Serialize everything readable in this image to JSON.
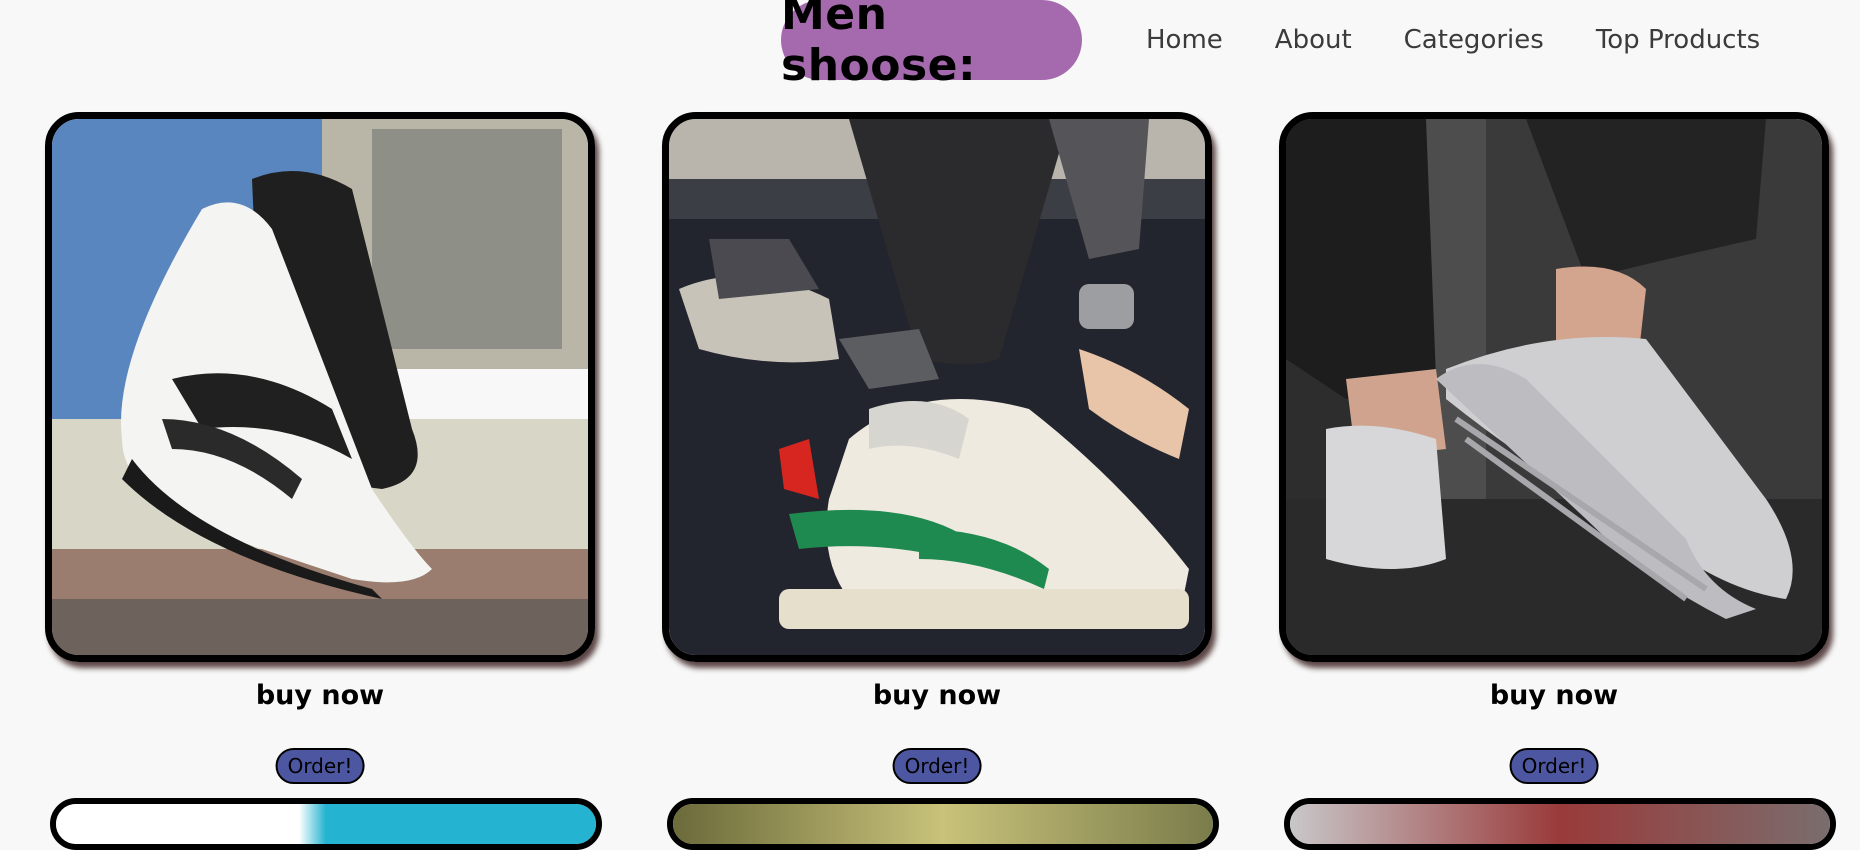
{
  "header": {
    "brand": "Men shoose:",
    "nav": [
      "Home",
      "About",
      "Categories",
      "Top Products"
    ]
  },
  "products": [
    {
      "caption": "buy now",
      "button": "Order!",
      "image": "white-black-puma-slip-on-sneaker"
    },
    {
      "caption": "buy now",
      "button": "Order!",
      "image": "cream-green-stripe-fashion-sneaker"
    },
    {
      "caption": "buy now",
      "button": "Order!",
      "image": "grey-knit-running-sneaker"
    }
  ],
  "colors": {
    "brand_bg": "#a56aad",
    "button_bg": "#4d56a0",
    "page_bg": "#f8f8f8"
  }
}
